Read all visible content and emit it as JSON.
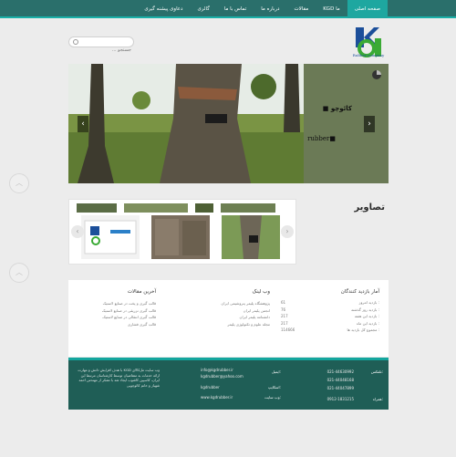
{
  "nav": {
    "items": [
      {
        "label": "صفحه اصلی",
        "active": true
      },
      {
        "label": "KGD ما",
        "active": false
      },
      {
        "label": "مقالات",
        "active": false
      },
      {
        "label": "درباره ما",
        "active": false
      },
      {
        "label": "تماس با ما",
        "active": false
      },
      {
        "label": "گالری",
        "active": false
      },
      {
        "label": "دعاوی پیشنه گیری",
        "active": false
      }
    ]
  },
  "header": {
    "search_placeholder": "جستجو ...",
    "logo_text": "Rubber company",
    "logo_letters": "KGD"
  },
  "slider": {
    "title_1": "■ کائوچو",
    "title_2": "rubber■"
  },
  "gallery": {
    "title": "تصاویر"
  },
  "stats": {
    "title": "آمار بازدید کنندگان",
    "rows": [
      {
        "label": "بازدید امروز :",
        "value": "61"
      },
      {
        "label": "بازدید روز گذشته :",
        "value": "76"
      },
      {
        "label": "بازدید این هفته :",
        "value": "217"
      },
      {
        "label": "بازدید این ماه :",
        "value": "217"
      },
      {
        "label": "مجموع کل بازدید ها :",
        "value": "114666"
      }
    ]
  },
  "weblinks": {
    "title": "وب لینک",
    "items": [
      "پژوهشگاه پلیمر پتروشیمی ایران",
      "انجمن پلیمر ایران",
      "دانشنامه پلیمر ایران",
      "مجله علوم و تکنولوژی پلیمر"
    ]
  },
  "articles": {
    "title": "آخرین مقالات",
    "items": [
      "قالب گیری و پخت در صنایع لاستیک",
      "قالب گیری تزریقی در صنایع لاستیک",
      "قالب گیری انتقالی در صنایع لاستیک",
      "قالب گیری فشاری"
    ]
  },
  "footer": {
    "phone_label": "تلفکس:",
    "fax_label": "همراه:",
    "phones": [
      "021-44630992",
      "021-44048168",
      "021-44047899"
    ],
    "mobile": "0912-1831215",
    "email_label": "ایمیل:",
    "emails": [
      "info@kgdrubber.ir",
      "kgdrubber@yahoo.com"
    ],
    "skype_label": "اسکایپ:",
    "skype": "kgdrubber",
    "website_label": "وب سایت:",
    "website": "www.kgdrubber.ir",
    "about": "وب سایت مل‌کالای KGD با هدف افزایش دانش و مهارت ارائه خدمات به متقاضیان توسط کارشناسان مرتبط این ایران، کاسپین کاشوب ایجاد شد با تشکر از مهندس احمد شهباز و خانم کائوچویی"
  },
  "colors": {
    "nav_bg": "#2a6f6b",
    "accent": "#1ea7a0",
    "footer_bg": "#1f5e56",
    "slider_panel": "#6b7a56"
  }
}
